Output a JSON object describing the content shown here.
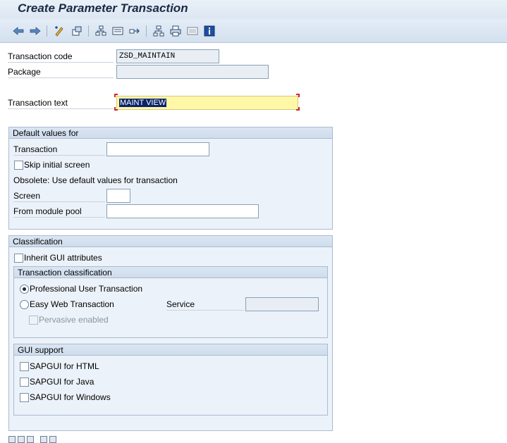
{
  "title": "Create Parameter Transaction",
  "toolbar": {
    "icons": [
      "back-icon",
      "forward-icon",
      "display-change-icon",
      "other-object-icon",
      "hierarchy-icon",
      "where-used-icon",
      "navigate-icon",
      "tree-icon",
      "print-icon",
      "layout-icon",
      "info-icon"
    ]
  },
  "header_fields": {
    "tcode_label": "Transaction code",
    "tcode_value": "ZSD_MAINTAIN",
    "package_label": "Package",
    "package_value": "",
    "text_label": "Transaction text",
    "text_value": "MAINT VIEW"
  },
  "default_values": {
    "title": "Default values for",
    "transaction_label": "Transaction",
    "transaction_value": "",
    "skip_label": "Skip initial screen",
    "obsolete_text": "Obsolete: Use default values for transaction",
    "screen_label": "Screen",
    "screen_value": "",
    "module_pool_label": "From module pool",
    "module_pool_value": ""
  },
  "classification": {
    "title": "Classification",
    "inherit_label": "Inherit GUI attributes",
    "tx_class_title": "Transaction classification",
    "professional_label": "Professional User Transaction",
    "easy_web_label": "Easy Web Transaction",
    "service_label": "Service",
    "service_value": "",
    "pervasive_label": "Pervasive enabled",
    "gui_support_title": "GUI support",
    "html_label": "SAPGUI for HTML",
    "java_label": "SAPGUI for Java",
    "windows_label": "SAPGUI for Windows"
  }
}
